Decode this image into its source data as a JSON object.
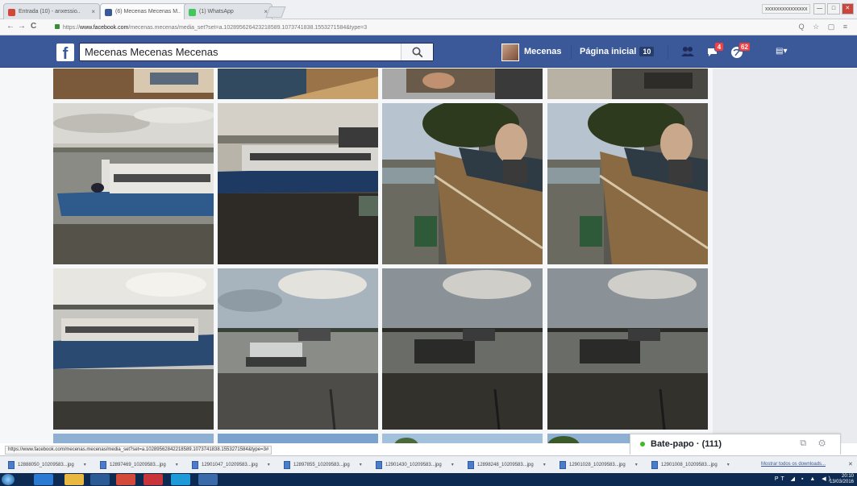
{
  "browser": {
    "tabs": [
      {
        "label": "Entrada (10) - anxessio..",
        "favicon_color": "#d44638"
      },
      {
        "label": "(6) Mecenas Mecenas M..",
        "favicon_color": "#3b5998"
      },
      {
        "label": "(1) WhatsApp",
        "favicon_color": "#43c55f"
      }
    ],
    "profile_label": "xxxxxxxxxxxxxxx",
    "window_buttons": [
      "—",
      "□",
      "✕"
    ],
    "url_prefix": "https://",
    "url_host": "www.facebook.com",
    "url_path": "/mecenas.mecenas/media_set?set=a.102895626423218589.1073741838.1553271584&type=3",
    "nav": {
      "back": "←",
      "forward": "→",
      "reload": "C"
    },
    "url_icons": "Q ☆ ▢ ≡"
  },
  "facebook": {
    "logo_letter": "f",
    "search_value": "Mecenas Mecenas Mecenas",
    "profile_name": "Mecenas",
    "home_label": "Página inicial",
    "home_count": "10",
    "messages_badge": "4",
    "notifications_badge": "62",
    "brand_color": "#3b5998",
    "settings_glyph": "▤▾"
  },
  "chat": {
    "label": "Bate-papo",
    "count": "(111)",
    "online_color": "#42b72a",
    "icons": "⧉ ⚙"
  },
  "status_url": "https://www.facebook.com/mecenas.mecenas/media_set?set=a.10289562842218589.1073741838.1553271584&type=3#",
  "downloads": [
    {
      "name": "12888050_10209583...jpg"
    },
    {
      "name": "12897469_10209583...jpg"
    },
    {
      "name": "12901047_10209583...jpg"
    },
    {
      "name": "12897855_10209583...jpg"
    },
    {
      "name": "12901430_10209583...jpg"
    },
    {
      "name": "12898248_10209583...jpg"
    },
    {
      "name": "12901028_10209583...jpg"
    },
    {
      "name": "12901008_10209583...jpg"
    }
  ],
  "downloads_show_all": "Mostrar todos os downloads...",
  "downloads_close": "✕",
  "taskbar": {
    "tray": "PT ◢ ▪ ▲ ◀) ",
    "time": "20:10",
    "date": "13/03/2016"
  }
}
